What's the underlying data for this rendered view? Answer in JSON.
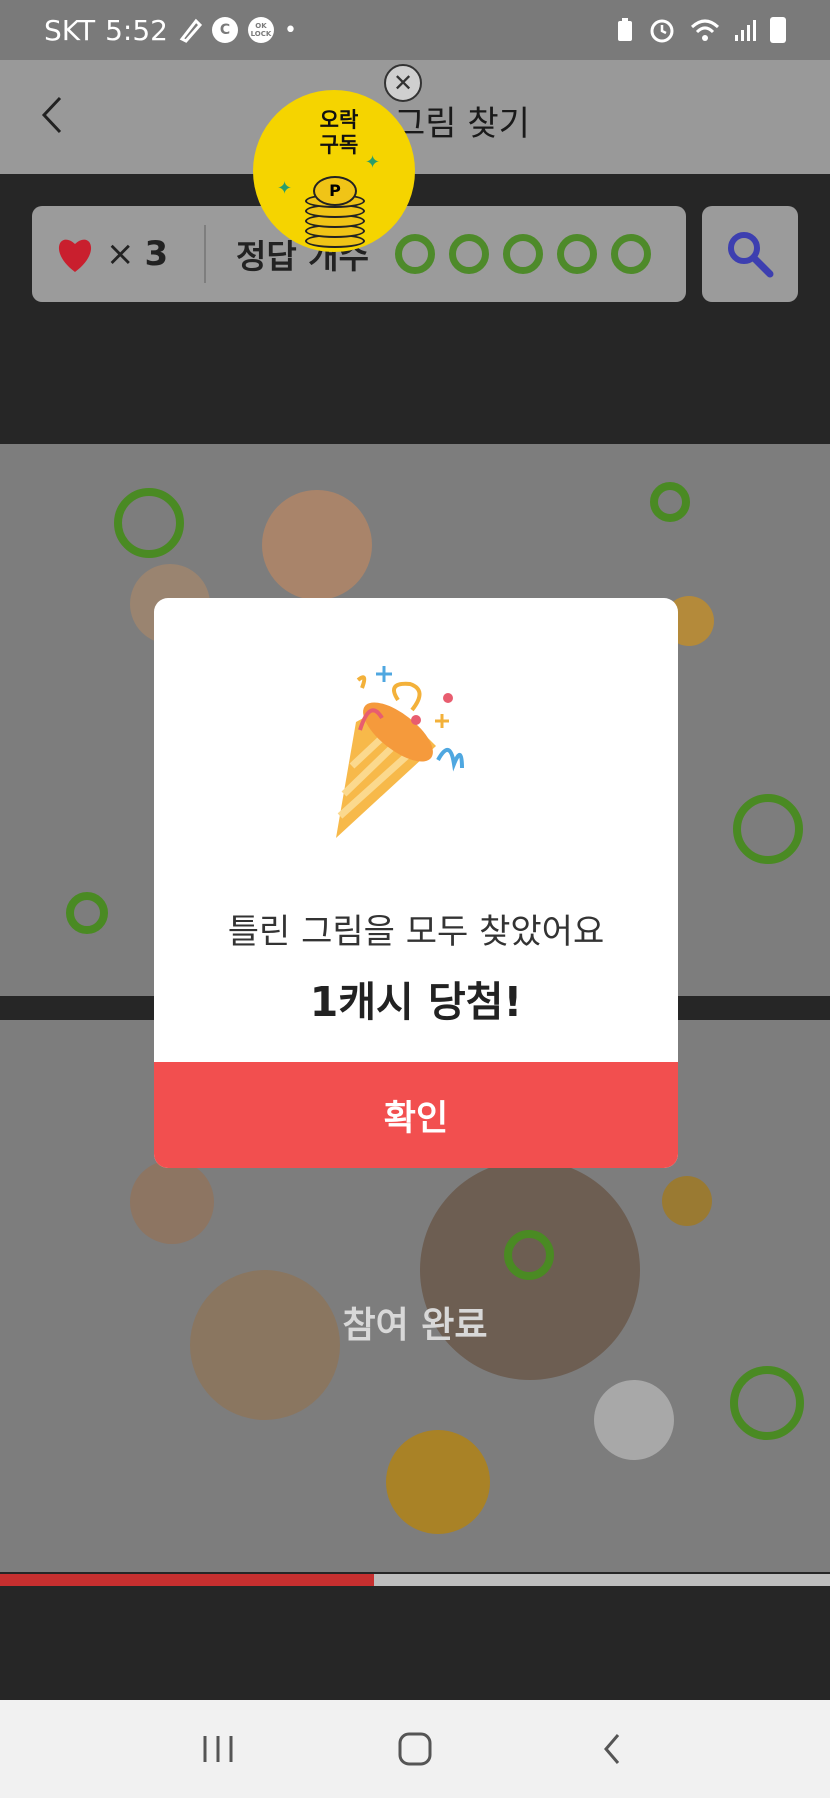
{
  "status_bar": {
    "carrier": "SKT",
    "time": "5:52",
    "icons": [
      "edit-icon",
      "c-circle-icon",
      "oklock-icon",
      "dot-icon",
      "battery-saver-icon",
      "alarm-icon",
      "wifi-icon",
      "signal-icon",
      "battery-icon"
    ],
    "oklock_label": "OK\nLOCK"
  },
  "header": {
    "title": "그림 찾기",
    "back_icon": "chevron-left-icon"
  },
  "promo": {
    "text": "오락\n구독",
    "close_icon": "close-circle-icon",
    "coin_letter": "P"
  },
  "toolbar": {
    "lives_icon": "heart-icon",
    "lives_x": "×",
    "lives_count": "3",
    "answers_label": "정답 개수",
    "answers_total": 5,
    "answers_found": 5,
    "search_icon": "search-icon"
  },
  "game": {
    "completed_text": "참여 완료",
    "progress_fraction": 0.45
  },
  "modal": {
    "illustration": "party-popper-icon",
    "message": "틀린 그림을 모두 찾았어요",
    "prize": "1캐시 당첨!",
    "confirm_label": "확인"
  },
  "nav_bar": {
    "items": [
      "recent-apps-icon",
      "home-icon",
      "back-icon"
    ]
  },
  "colors": {
    "accent_red": "#f24f4f",
    "marker_green": "#4e8a2a",
    "search_blue": "#3d3fb0",
    "heart_red": "#c91f2e",
    "promo_yellow": "#f5d400"
  }
}
